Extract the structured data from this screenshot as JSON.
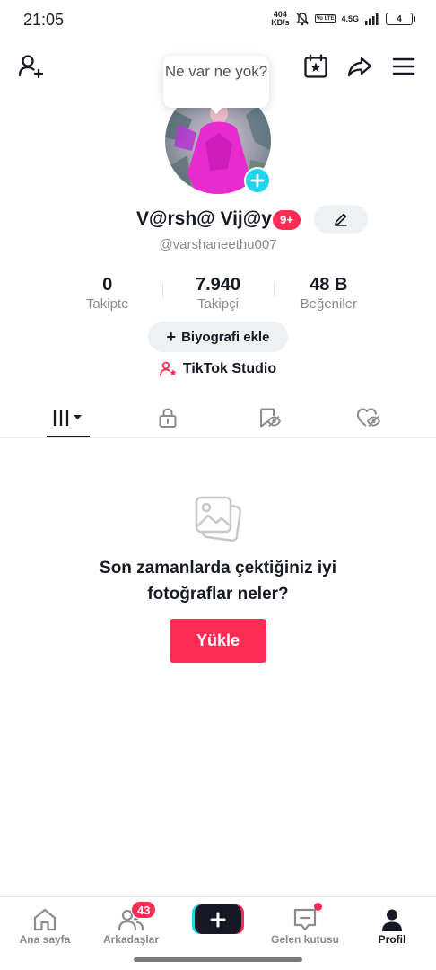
{
  "status_bar": {
    "time": "21:05",
    "net_speed_value": "404",
    "net_speed_unit": "KB/s",
    "volte": "Vo LTE",
    "network": "4.5G",
    "battery": "4"
  },
  "top_nav": {
    "add_friend_icon": "person-plus-icon",
    "calendar_icon": "calendar-star-icon",
    "share_icon": "share-arrow-icon",
    "menu_icon": "hamburger-menu-icon"
  },
  "tooltip": {
    "text": "Ne var ne yok?"
  },
  "profile": {
    "display_name": "V@rsh@ Vij@y",
    "badge": "9+",
    "username": "@varshaneethu007"
  },
  "stats": [
    {
      "value": "0",
      "label": "Takipte"
    },
    {
      "value": "7.940",
      "label": "Takipçi"
    },
    {
      "value": "48 B",
      "label": "Beğeniler"
    }
  ],
  "bio_button": {
    "plus": "+",
    "label": "Biyografi ekle"
  },
  "studio": {
    "label": "TikTok Studio"
  },
  "tabs": [
    {
      "icon": "videos-grid-icon",
      "active": true
    },
    {
      "icon": "lock-icon",
      "active": false
    },
    {
      "icon": "bookmark-eye-icon",
      "active": false
    },
    {
      "icon": "heart-eye-icon",
      "active": false
    }
  ],
  "empty_state": {
    "line1": "Son zamanlarda çektiğiniz iyi",
    "line2": "fotoğraflar neler?",
    "button": "Yükle"
  },
  "bottom_nav": {
    "home": "Ana sayfa",
    "friends": "Arkadaşlar",
    "friends_count": "43",
    "inbox": "Gelen kutusu",
    "profile": "Profil"
  },
  "colors": {
    "accent": "#fe2c55",
    "cyan": "#20d5ec",
    "text": "#161823",
    "muted": "#8a8b91"
  }
}
